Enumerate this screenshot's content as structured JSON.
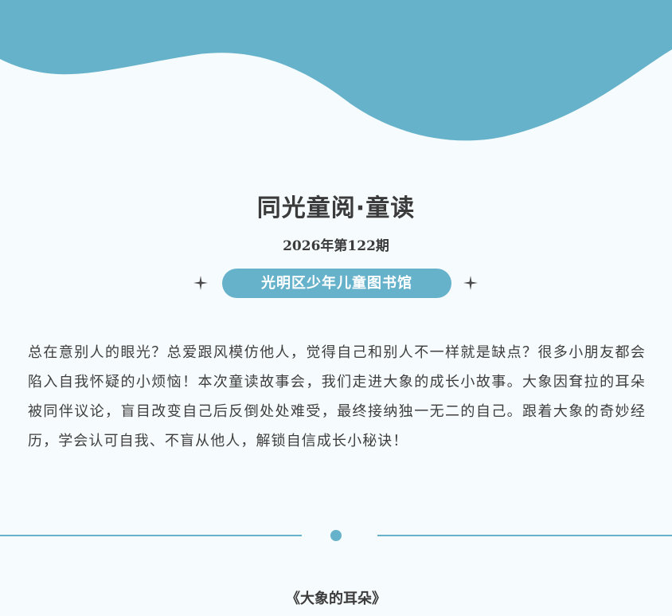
{
  "header": {
    "title": "同光童阅·童读",
    "issue": "2026年第122期",
    "organizer": "光明区少年儿童图书馆"
  },
  "intro": {
    "text": "总在意别人的眼光？总爱跟风模仿他人，觉得自己和别人不一样就是缺点？很多小朋友都会陷入自我怀疑的小烦恼！本次童读故事会，我们走进大象的成长小故事。大象因耷拉的耳朵被同伴议论，盲目改变自己后反倒处处难受，最终接纳独一无二的自己。跟着大象的奇妙经历，学会认可自我、不盲从他人，解锁自信成长小秘诀！"
  },
  "story": {
    "title": "《大象的耳朵》"
  },
  "colors": {
    "accent": "#66b2cb",
    "background": "#f6fbfd",
    "text": "#3b3b3b"
  }
}
